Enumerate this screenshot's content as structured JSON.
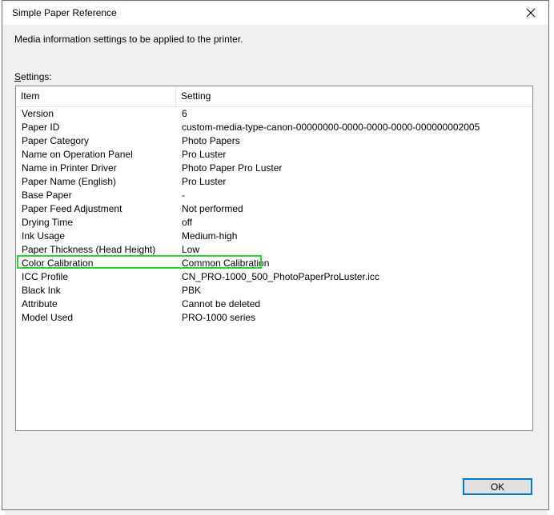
{
  "window": {
    "title": "Simple Paper Reference",
    "description": "Media information settings to be applied to the printer.",
    "settings_label_mnemonic": "S",
    "settings_label_rest": "ettings:"
  },
  "table": {
    "columns": [
      "Item",
      "Setting"
    ],
    "rows": [
      {
        "item": "Version",
        "setting": "6"
      },
      {
        "item": "Paper ID",
        "setting": "custom-media-type-canon-00000000-0000-0000-0000-000000002005"
      },
      {
        "item": "Paper Category",
        "setting": "Photo Papers"
      },
      {
        "item": "Name on Operation Panel",
        "setting": "Pro Luster"
      },
      {
        "item": "Name in Printer Driver",
        "setting": "Photo Paper Pro Luster"
      },
      {
        "item": "Paper Name (English)",
        "setting": "Pro Luster"
      },
      {
        "item": "Base Paper",
        "setting": "-"
      },
      {
        "item": "Paper Feed Adjustment",
        "setting": "Not performed"
      },
      {
        "item": "Drying Time",
        "setting": "off"
      },
      {
        "item": "Ink Usage",
        "setting": "Medium-high"
      },
      {
        "item": "Paper Thickness (Head Height)",
        "setting": "Low"
      },
      {
        "item": "Color Calibration",
        "setting": "Common Calibration"
      },
      {
        "item": "ICC Profile",
        "setting": "CN_PRO-1000_500_PhotoPaperProLuster.icc"
      },
      {
        "item": "Black Ink",
        "setting": "PBK"
      },
      {
        "item": "Attribute",
        "setting": "Cannot be deleted"
      },
      {
        "item": "Model Used",
        "setting": "PRO-1000 series"
      }
    ]
  },
  "buttons": {
    "ok": "OK",
    "close_glyph": "✕"
  },
  "colors": {
    "highlight": "#2bd52b",
    "focus_border": "#0078d7"
  }
}
